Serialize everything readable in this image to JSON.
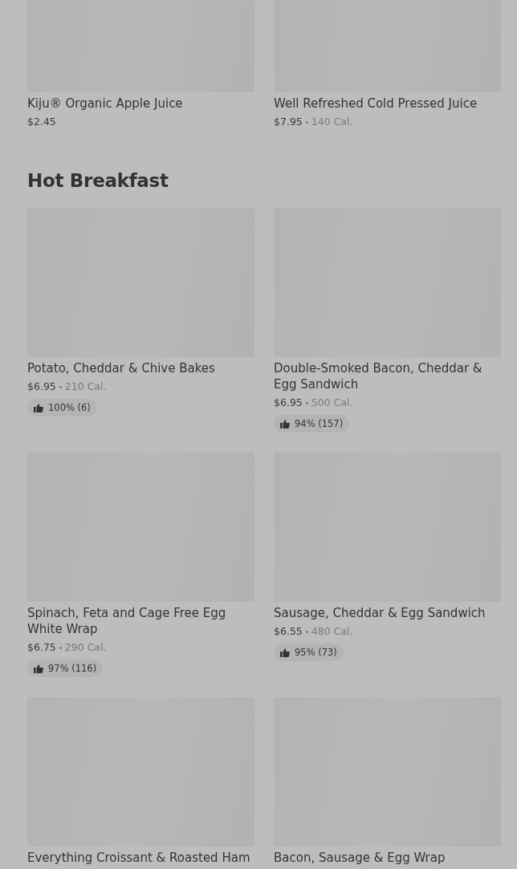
{
  "sections": [
    {
      "items": [
        {
          "name": "Kiju® Organic Apple Juice",
          "price": "$2.45"
        },
        {
          "name": "Well Refreshed Cold Pressed Juice",
          "price": "$7.95",
          "calories": "140 Cal."
        }
      ]
    },
    {
      "title": "Hot Breakfast",
      "items": [
        {
          "name": "Potato, Cheddar & Chive Bakes",
          "price": "$6.95",
          "calories": "210 Cal.",
          "rating": "100% (6)"
        },
        {
          "name": "Double-Smoked Bacon, Cheddar & Egg Sandwich",
          "price": "$6.95",
          "calories": "500 Cal.",
          "rating": "94% (157)"
        },
        {
          "name": "Spinach, Feta and Cage Free Egg White Wrap",
          "price": "$6.75",
          "calories": "290 Cal.",
          "rating": "97% (116)"
        },
        {
          "name": "Sausage, Cheddar & Egg Sandwich",
          "price": "$6.55",
          "calories": "480 Cal.",
          "rating": "95% (73)"
        },
        {
          "name": "Everything Croissant & Roasted Ham"
        },
        {
          "name": "Bacon, Sausage & Egg Wrap"
        }
      ]
    }
  ]
}
